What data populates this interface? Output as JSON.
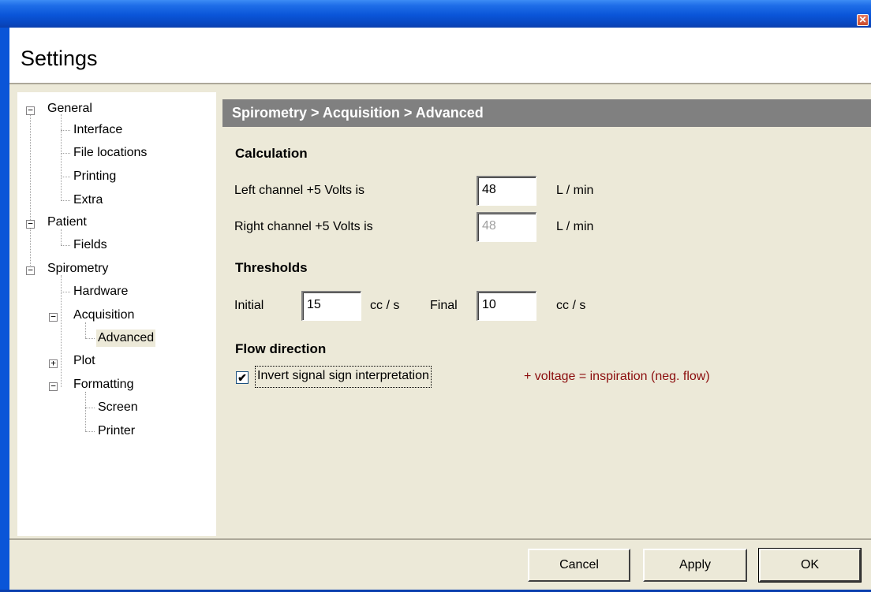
{
  "window": {
    "close_glyph": "✕",
    "header_title": "Settings"
  },
  "tree": [
    {
      "label": "General",
      "expander": "−"
    },
    {
      "label": "Interface"
    },
    {
      "label": "File locations"
    },
    {
      "label": "Printing"
    },
    {
      "label": "Extra"
    },
    {
      "label": "Patient",
      "expander": "−"
    },
    {
      "label": "Fields"
    },
    {
      "label": "Spirometry",
      "expander": "−"
    },
    {
      "label": "Hardware"
    },
    {
      "label": "Acquisition",
      "expander": "−"
    },
    {
      "label": "Advanced",
      "selected": true
    },
    {
      "label": "Plot",
      "expander": "+"
    },
    {
      "label": "Formatting",
      "expander": "−"
    },
    {
      "label": "Screen"
    },
    {
      "label": "Printer"
    }
  ],
  "content": {
    "breadcrumb": "Spirometry > Acquisition > Advanced",
    "calculation": {
      "heading": "Calculation",
      "left_label": "Left channel  +5 Volts  is",
      "left_value": "48",
      "left_unit": "L / min",
      "right_label": "Right channel  +5 Volts  is",
      "right_value": "48",
      "right_unit": "L / min"
    },
    "thresholds": {
      "heading": "Thresholds",
      "initial_label": "Initial",
      "initial_value": "15",
      "initial_unit": "cc / s",
      "final_label": "Final",
      "final_value": "10",
      "final_unit": "cc / s"
    },
    "flow": {
      "heading": "Flow direction",
      "checkbox_checked": true,
      "checkbox_glyph": "✔",
      "checkbox_label": "Invert signal sign interpretation",
      "note": "+ voltage = inspiration (neg. flow)"
    }
  },
  "buttons": {
    "cancel": "Cancel",
    "apply": "Apply",
    "ok": "OK"
  },
  "colors": {
    "note_text": "#8b0d0d",
    "breadcrumb_bar": "#808080",
    "titlebar": "#0a55d8"
  }
}
